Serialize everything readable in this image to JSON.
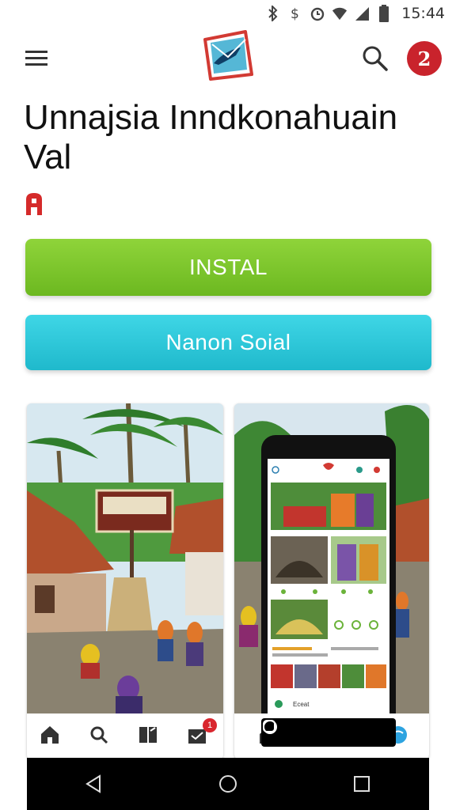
{
  "status_bar": {
    "time": "15:44",
    "icons": [
      "bluetooth-icon",
      "dollar-icon",
      "alarm-icon",
      "wifi-icon",
      "signal-icon",
      "battery-icon"
    ]
  },
  "app_bar": {
    "menu_icon": "hamburger-menu-icon",
    "logo_icon": "envelope-fish-logo",
    "search_icon": "search-icon",
    "avatar_text": "2"
  },
  "app": {
    "title": "Unnajsia Inndkonahuain Val",
    "rating_icon": "age-rating-badge"
  },
  "buttons": {
    "install_label": "INSTAL",
    "secondary_label": "Nanon Soial"
  },
  "screenshots": [
    {
      "sign_text": "",
      "nav_icons": [
        "home-icon",
        "search-icon",
        "book-icon",
        "inbox-icon"
      ],
      "notification_count": "1"
    },
    {
      "phone_caption": "Eceat",
      "nav_icons": [
        "home-icon",
        "circle-icon",
        "chat-icon"
      ]
    }
  ],
  "system_nav": {
    "icons": [
      "back-triangle-icon",
      "home-circle-icon",
      "recents-square-icon"
    ]
  },
  "colors": {
    "install": "#7cc82b",
    "secondary": "#2cc7d9",
    "avatar": "#c9232c",
    "accent_red": "#d9262e"
  }
}
